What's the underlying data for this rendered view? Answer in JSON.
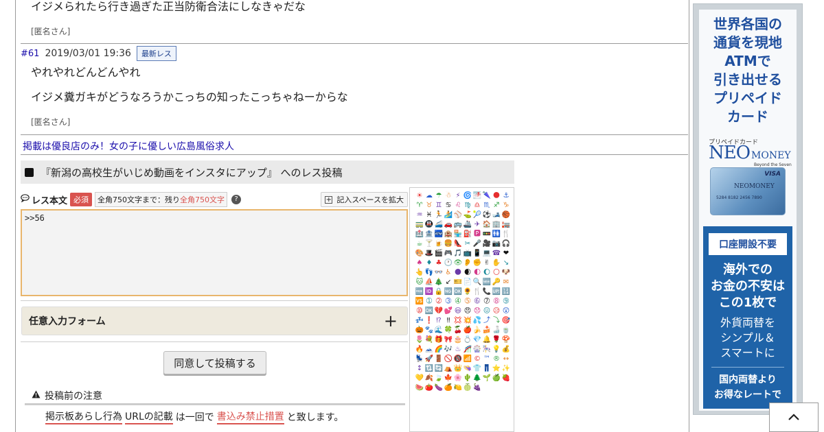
{
  "thread": {
    "post60_last_line": "イジメられたら行き過ぎた正当防衛合法にしなきゃだな",
    "post60_author": "[匿名さん]",
    "post61": {
      "number": "#61",
      "date": "2019/03/01 19:36",
      "badge": "最新レス",
      "line1": "やれやれどんどんやれ",
      "line2": "イジメ糞ガキがどうなろうかこっちの知ったこっちゃねーからな",
      "author": "[匿名さん]"
    },
    "ad_link": "掲載は優良店のみ！女の子に優しい広島風俗求人"
  },
  "reply_form": {
    "title": "『新潟の高校生がいじめ動画をインスタにアップ』 へのレス投稿",
    "body_label": "レス本文",
    "required_badge": "必須",
    "counter_prefix": "全角750文字まで：残り",
    "counter_remaining": "全角750文字",
    "help_icon_glyph": "?",
    "expand_button": "記入スペースを拡大",
    "textarea_value": ">>56",
    "optional_section": "任意入力フォーム",
    "optional_toggle": "+",
    "submit_button": "同意して投稿する",
    "notice_title": "投稿前の注意",
    "notice": {
      "link1": "掲示板あらし行為",
      "link2": "URLの記載",
      "text1": "は一回で",
      "link3": "書込み禁止措置",
      "text2": "と致します。"
    }
  },
  "emoji_panel": {
    "icons": [
      "☀",
      "☁",
      "☂",
      "☃",
      "⚡",
      "🌀",
      "🌁",
      "🌂",
      "🌑",
      "⚓",
      "♈",
      "♉",
      "♊",
      "♋",
      "♌",
      "♍",
      "♎",
      "♏",
      "♐",
      "♑",
      "♒",
      "♓",
      "🏃",
      "🏄",
      "⚾",
      "⛳",
      "🎾",
      "⚽",
      "🎿",
      "🏀",
      "🚃",
      "🚇",
      "🚄",
      "🚗",
      "🚌",
      "🚢",
      "✈",
      "🏠",
      "🏢",
      "🏣",
      "🏥",
      "🏦",
      "🏧",
      "🏨",
      "🏪",
      "⛽",
      "🅿",
      "🚥",
      "🚻",
      "🍴",
      "☕",
      "🍸",
      "🍺",
      "🍔",
      "👠",
      "✂",
      "🎤",
      "🎥",
      "📷",
      "🎧",
      "🎨",
      "🎩",
      "🎬",
      "🎮",
      "🎵",
      "📺",
      "📱",
      "💻",
      "☎",
      "❤",
      "♠",
      "♦",
      "♣",
      "🕐",
      "👁",
      "👂",
      "✊",
      "✌",
      "✋",
      "↘",
      "👆",
      "👣",
      "👓",
      "♿",
      "🌑",
      "🌒",
      "🌓",
      "🌔",
      "🌕",
      "🐶",
      "🐱",
      "⛵",
      "🎄",
      "↙",
      "🎫",
      "📄",
      "🔍",
      "🆕",
      "🔑",
      "✉",
      "🆓",
      "🆔",
      "🔒",
      "🆖",
      "🆗",
      "🌻",
      "🍴",
      "📞",
      "🆙",
      "🔢",
      "🆚",
      "➀",
      "➁",
      "➂",
      "➃",
      "➄",
      "➅",
      "➆",
      "➇",
      "➈",
      "➉",
      "🆗",
      "💔",
      "💕",
      "😃",
      "😠",
      "😞",
      "😖",
      "😥",
      "😲",
      "💤",
      "❗",
      "⁉",
      "‼",
      "💢",
      "💥",
      "💦",
      "⤴",
      "⤵",
      "🎯",
      "🎃",
      "🐾",
      "🌊",
      "🍀",
      "🍒",
      "🍎",
      "🍌",
      "🍰",
      "🍶",
      "🍵",
      "🌷",
      "💐",
      "🎁",
      "🎀",
      "🎂",
      "💍",
      "💎",
      "🔔",
      "🌹",
      "🍄",
      "🔥",
      "🗻",
      "🌈",
      "🎶",
      "♨",
      "🎢",
      "🎡",
      "🎠",
      "💡",
      "💰",
      "💺",
      "🚀",
      "🚪",
      "🚫",
      "🔞",
      "📶",
      "©",
      "™",
      "®",
      "↔",
      "↕",
      "🔃",
      "🔄",
      "⛺",
      "👑",
      "👒",
      "👕",
      "👖",
      "⭐",
      "✨",
      "💛",
      "🍂",
      "🍃",
      "🍁",
      "🌸",
      "🌵",
      "🌲",
      "🌱",
      "🍏",
      "🍓",
      "🍉",
      "🍅",
      "🍆",
      "🍊",
      "🍋",
      "🍈",
      "🍇"
    ],
    "palette": [
      "#e62e2e",
      "#2a5fcf",
      "#2a9d3a",
      "#e67e22",
      "#6a3aa8",
      "#111111",
      "#d43a8a",
      "#1a8a9a"
    ]
  },
  "sidebar_ad": {
    "headline": "世界各国の通貨を現地ATMで引き出せるプリペイドカード",
    "headline_lines": [
      "世界各国の",
      "通貨を現地",
      "ATMで",
      "引き出せる",
      "プリペイド",
      "カード"
    ],
    "small_label": "プリペイドカード",
    "logo_big": "NEO",
    "logo_rest": "MONEY",
    "logo_tagline": "Beyond the Seven Seas",
    "card_brand": "NEOMONEY",
    "card_network": "VISA",
    "card_digits": "5284 8182 2456 7890",
    "pill": "口座開設不要",
    "bold_lines": [
      "海外での",
      "お金の不安は",
      "この1枚で"
    ],
    "white_lines": [
      "外貨両替を",
      "シンプル＆",
      "スマートに"
    ],
    "foot_lines": [
      "国内両替より",
      "お得なレートで"
    ]
  },
  "scroll_top_icon": "chevron-up"
}
